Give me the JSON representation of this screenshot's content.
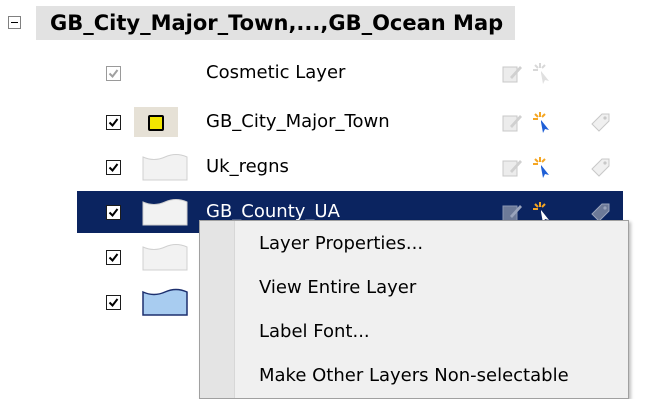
{
  "tree": {
    "root_label": "GB_City_Major_Town,...,GB_Ocean Map",
    "layers": [
      {
        "label": "Cosmetic Layer",
        "checked": true,
        "enabled": false
      },
      {
        "label": "GB_City_Major_Town",
        "checked": true
      },
      {
        "label": "Uk_regns",
        "checked": true
      },
      {
        "label": "GB_County_UA",
        "checked": true,
        "selected": true
      },
      {
        "label": "",
        "checked": true
      },
      {
        "label": "",
        "checked": true
      }
    ]
  },
  "context_menu": {
    "items": [
      {
        "label": "Layer Properties..."
      },
      {
        "label": "View Entire Layer"
      },
      {
        "label": "Label Font..."
      },
      {
        "label": "Make Other Layers Non-selectable"
      }
    ]
  },
  "colors": {
    "selection": "#0b2460",
    "root_highlight": "#e2e2e2",
    "point_symbol": "#f2e600",
    "ocean_fill": "#a8ccf0"
  },
  "icons": [
    "expander-minus-icon",
    "checkbox-icon",
    "edit-pencil-icon",
    "selectable-pointer-icon",
    "label-tag-icon"
  ]
}
